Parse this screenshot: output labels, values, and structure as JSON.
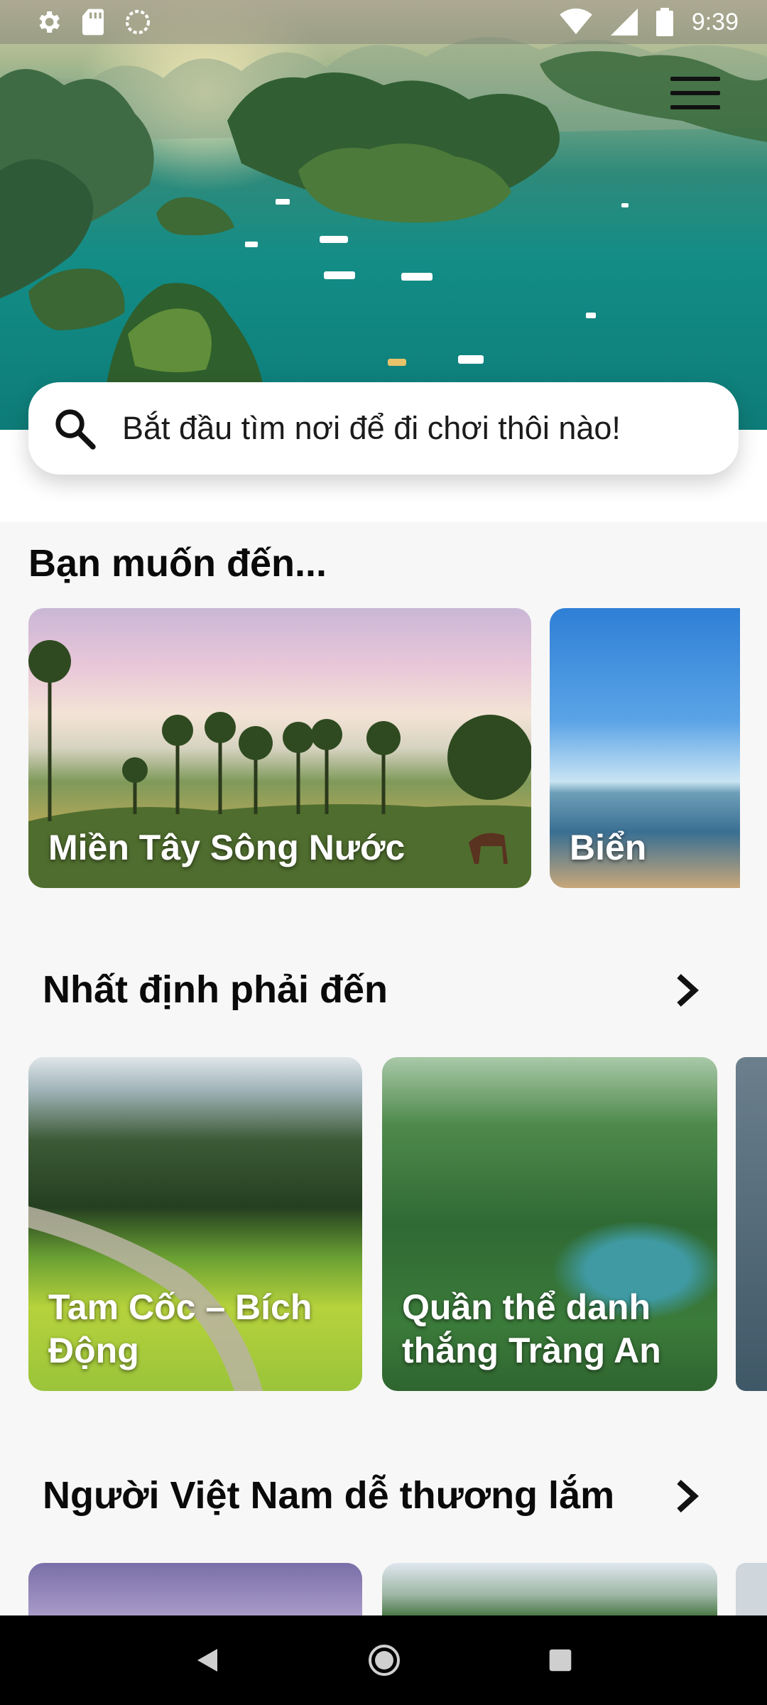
{
  "status_bar": {
    "time": "9:39",
    "left_icons": [
      "settings-icon",
      "sd-card-icon",
      "sync-icon"
    ],
    "right_icons": [
      "wifi-icon",
      "signal-icon",
      "battery-icon"
    ]
  },
  "header": {
    "menu_icon": "hamburger-menu-icon"
  },
  "search": {
    "icon": "search-icon",
    "placeholder": "Bắt đầu tìm nơi để đi chơi thôi nào!"
  },
  "categories": {
    "title": "Bạn muốn đến...",
    "items": [
      {
        "label": "Miền Tây Sông Nước"
      },
      {
        "label": "Biển"
      }
    ]
  },
  "must_visit": {
    "title": "Nhất định phải đến",
    "items": [
      {
        "label": "Tam Cốc – Bích Động"
      },
      {
        "label": "Quần thể danh thắng Tràng An"
      }
    ]
  },
  "people": {
    "title": "Người Việt Nam dễ thương lắm",
    "items": [
      {
        "label": ""
      },
      {
        "label": ""
      }
    ]
  },
  "nav_bar": {
    "buttons": [
      "back-icon",
      "home-icon",
      "recents-icon"
    ]
  }
}
